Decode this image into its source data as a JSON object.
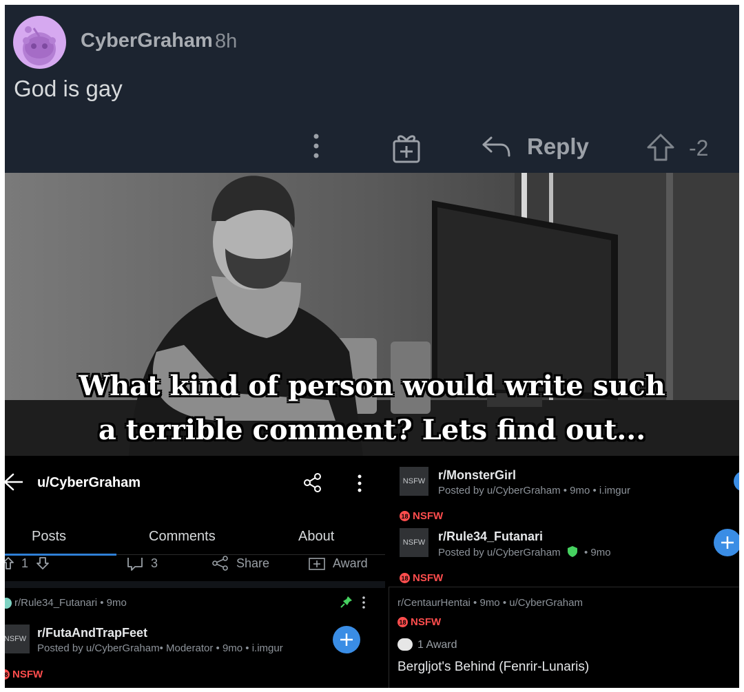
{
  "comment": {
    "username": "CyberGraham",
    "age": "8h",
    "body": "God is gay",
    "reply_label": "Reply",
    "score": "-2"
  },
  "meme": {
    "caption": "What kind of person would write such a terrible comment? Lets find out..."
  },
  "profile": {
    "username": "u/CyberGraham",
    "tabs": [
      "Posts",
      "Comments",
      "About"
    ],
    "post_actions": {
      "votes": "1",
      "comments": "3",
      "share": "Share",
      "award": "Award"
    },
    "pinned_meta": "r/Rule34_Futanari • 9mo",
    "post": {
      "thumb": "NSFW",
      "subreddit": "r/FutaAndTrapFeet",
      "meta": "Posted by u/CyberGraham• Moderator • 9mo • i.imgur",
      "tag": "NSFW"
    }
  },
  "right_posts": [
    {
      "thumb": "NSFW",
      "subreddit": "r/MonsterGirl",
      "meta": "Posted by u/CyberGraham • 9mo • i.imgur",
      "tag": "NSFW"
    },
    {
      "thumb": "NSFW",
      "subreddit": "r/Rule34_Futanari",
      "meta_before": "Posted by u/CyberGraham",
      "meta_after": "• 9mo",
      "tag": "NSFW"
    }
  ],
  "last_card": {
    "meta": "r/CentaurHentai • 9mo • u/CyberGraham",
    "tag": "NSFW",
    "awards": "1 Award",
    "title": "Bergljot's Behind (Fenrir-Lunaris)"
  },
  "nsfw_badge_text": "18",
  "colors": {
    "comment_bg": "#1c2430",
    "accent_blue": "#3a8de5",
    "nsfw_red": "#ff4d4d",
    "mod_green": "#46d160",
    "avatar_purple": "#d6a9f0"
  }
}
